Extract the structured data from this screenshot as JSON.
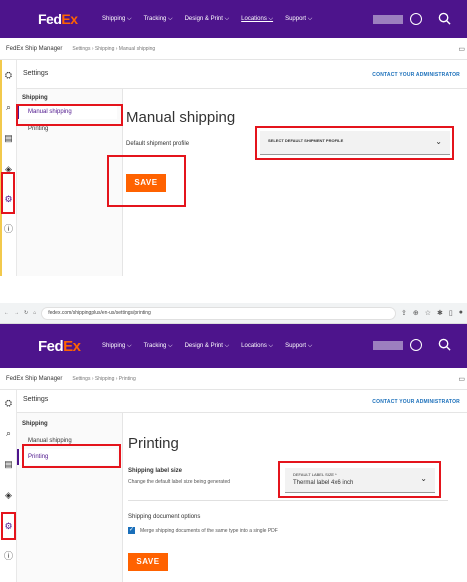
{
  "brand": {
    "fed": "Fed",
    "ex": "Ex"
  },
  "nav": {
    "items": [
      "Shipping ⌵",
      "Tracking ⌵",
      "Design & Print ⌵",
      "Locations ⌵",
      "Support ⌵"
    ]
  },
  "browser": {
    "url": "fedex.com/shippingplus/en-us/settings/printing"
  },
  "subbar": {
    "title": "FedEx Ship Manager",
    "crumb1": "Settings › Shipping › Manual shipping",
    "crumb2": "Settings › Shipping › Printing"
  },
  "settings": {
    "heading": "Settings",
    "contact": "CONTACT YOUR ADMINISTRATOR"
  },
  "leftnav": {
    "section": "Shipping",
    "item1": "Manual shipping",
    "item2": "Printing"
  },
  "screen1": {
    "title": "Manual shipping",
    "field_label": "Default shipment profile",
    "dropdown_placeholder": "SELECT DEFAULT SHIPMENT PROFILE",
    "save": "SAVE"
  },
  "screen2": {
    "title": "Printing",
    "label_size_heading": "Shipping label size",
    "label_size_desc": "Change the default label size being generated",
    "dropdown_label": "DEFAULT LABEL SIZE *",
    "dropdown_value": "Thermal label 4x6 inch",
    "doc_options_heading": "Shipping document options",
    "checkbox_label": "Merge shipping documents of the same type into a single PDF",
    "checkbox_checked": true,
    "save": "SAVE"
  },
  "colors": {
    "brand_purple": "#4d148c",
    "brand_orange": "#ff6200",
    "highlight_red": "#e4141c",
    "link_blue": "#1a6fba"
  },
  "icons": [
    "shipments-icon",
    "package-search-icon",
    "clipboard-icon",
    "layers-icon",
    "settings-gear-icon",
    "info-icon",
    "search-icon",
    "user-avatar-icon",
    "chevron-down-icon",
    "check-icon",
    "chat-icon"
  ]
}
